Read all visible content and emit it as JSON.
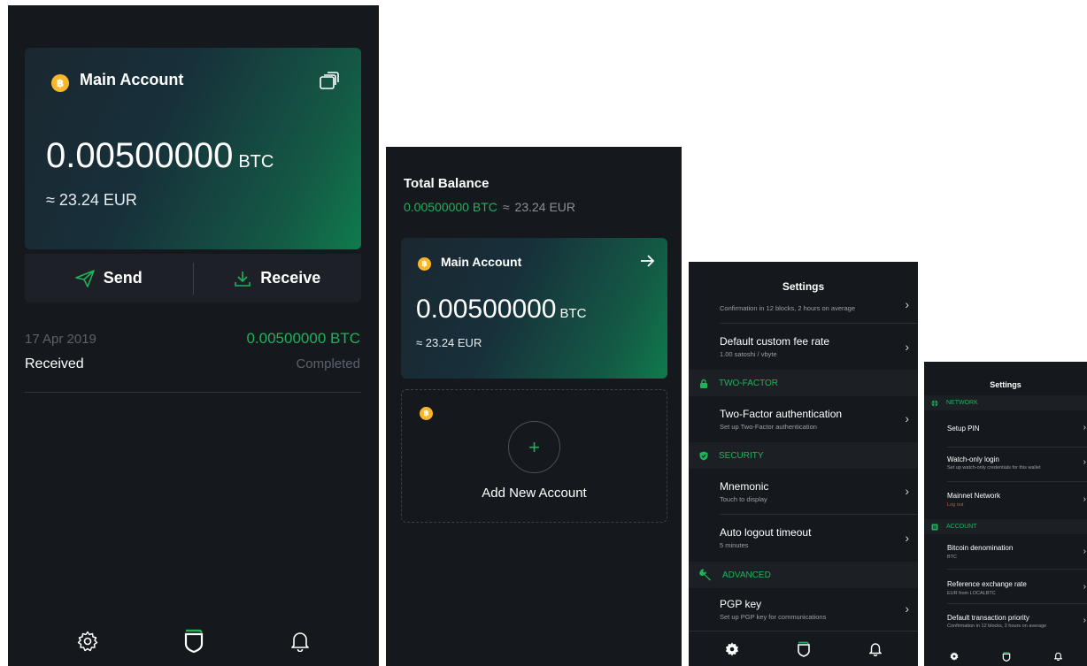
{
  "screen1": {
    "account_name": "Main Account",
    "balance": "0.00500000",
    "unit": "BTC",
    "fiat": "≈ 23.24 EUR",
    "send_label": "Send",
    "receive_label": "Receive",
    "transaction": {
      "date": "17 Apr 2019",
      "amount": "0.00500000 BTC",
      "type": "Received",
      "status": "Completed"
    }
  },
  "screen2": {
    "total_label": "Total Balance",
    "total_btc": "0.00500000 BTC",
    "total_approx": "≈",
    "total_fiat": "23.24 EUR",
    "account_name": "Main Account",
    "balance": "0.00500000",
    "unit": "BTC",
    "fiat": "≈ 23.24 EUR",
    "add_label": "Add New Account",
    "add_symbol": "+"
  },
  "screen3": {
    "title": "Settings",
    "top_partial_sub": "Confirmation in 12 blocks, 2 hours on average",
    "rows": [
      {
        "title": "Default custom fee rate",
        "sub": "1.00 satoshi / vbyte"
      },
      {
        "title": "Two-Factor authentication",
        "sub": "Set up Two-Factor authentication"
      },
      {
        "title": "Mnemonic",
        "sub": "Touch to display"
      },
      {
        "title": "Auto logout timeout",
        "sub": "5 minutes"
      },
      {
        "title": "PGP key",
        "sub": "Set up PGP key for communications"
      }
    ],
    "sections": {
      "two_factor": "TWO-FACTOR",
      "security": "SECURITY",
      "advanced": "ADVANCED"
    }
  },
  "screen4": {
    "title": "Settings",
    "sections": {
      "network": "NETWORK",
      "account": "ACCOUNT"
    },
    "rows": [
      {
        "title": "Setup PIN",
        "sub": ""
      },
      {
        "title": "Watch-only login",
        "sub": "Set up watch-only credentials for this wallet"
      },
      {
        "title": "Mainnet Network",
        "sub": "Log out"
      },
      {
        "title": "Bitcoin denomination",
        "sub": "BTC"
      },
      {
        "title": "Reference exchange rate",
        "sub": "EUR from LOCALBTC"
      },
      {
        "title": "Default transaction priority",
        "sub": "Confirmation in 12 blocks, 2 hours on average"
      }
    ]
  },
  "colors": {
    "background": "#15181d",
    "accent": "#1fb25a",
    "bitcoin": "#f7b72b",
    "danger": "#e0484c"
  },
  "icons": {
    "bitcoin": "bitcoin-icon",
    "accounts": "stacked-cards-icon",
    "send": "paper-plane-icon",
    "receive": "download-icon",
    "settings": "gear-icon",
    "wallet": "shield-icon",
    "notifications": "bell-icon",
    "arrow": "arrow-right-icon",
    "lock": "lock-icon",
    "security": "shield-check-icon",
    "advanced": "wrench-icon",
    "network": "globe-icon",
    "account": "id-card-icon"
  }
}
